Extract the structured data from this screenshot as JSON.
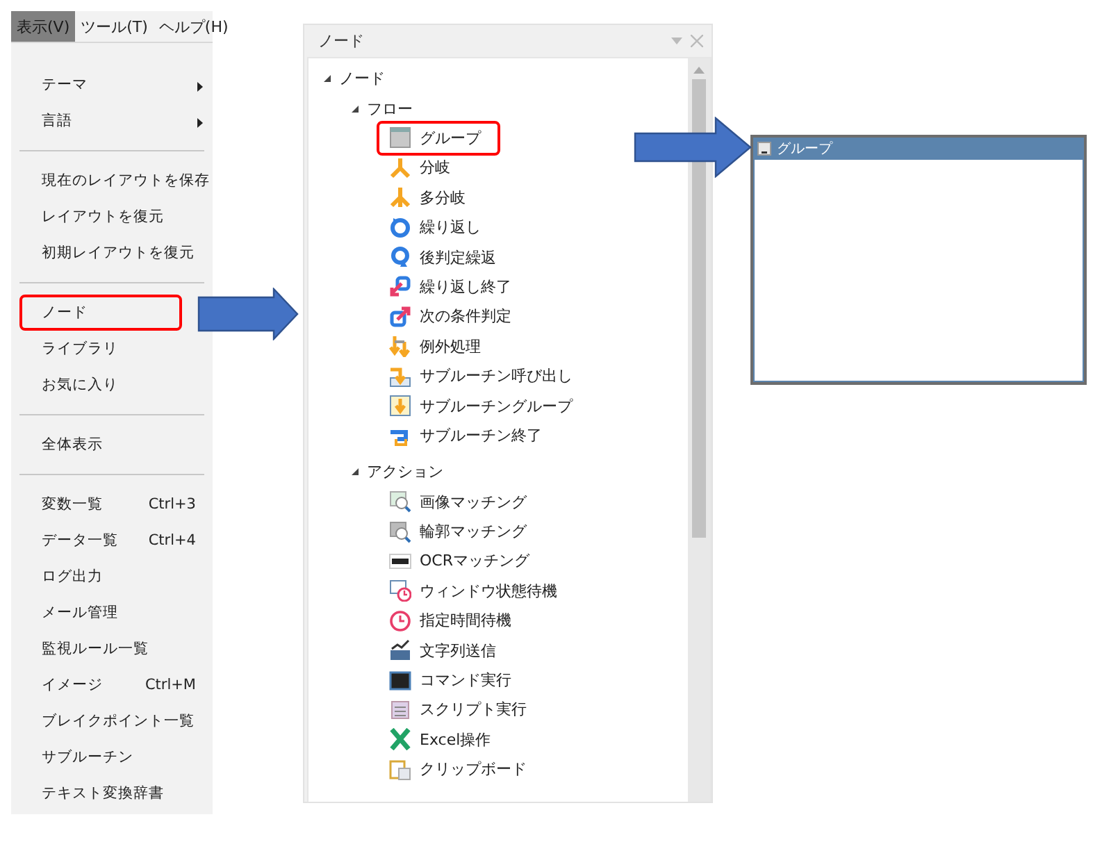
{
  "menubar": [
    {
      "label": "表示(V)",
      "selected": true
    },
    {
      "label": "ツール(T)",
      "selected": false
    },
    {
      "label": "ヘルプ(H)",
      "selected": false
    }
  ],
  "menu": {
    "groups": [
      [
        {
          "label": "テーマ",
          "submenu": true,
          "highlighted": false
        },
        {
          "label": "言語",
          "submenu": true,
          "highlighted": false
        }
      ],
      [
        {
          "label": "現在のレイアウトを保存",
          "submenu": false,
          "highlighted": false
        },
        {
          "label": "レイアウトを復元",
          "submenu": false,
          "highlighted": false
        },
        {
          "label": "初期レイアウトを復元",
          "submenu": false,
          "highlighted": false
        }
      ],
      [
        {
          "label": "ノード",
          "submenu": false,
          "highlighted": true
        },
        {
          "label": "ライブラリ",
          "submenu": false,
          "highlighted": false
        },
        {
          "label": "お気に入り",
          "submenu": false,
          "highlighted": false
        }
      ],
      [
        {
          "label": "全体表示",
          "submenu": false,
          "highlighted": false
        }
      ],
      [
        {
          "label": "変数一覧",
          "shortcut": "Ctrl+3",
          "submenu": false,
          "highlighted": false
        },
        {
          "label": "データ一覧",
          "shortcut": "Ctrl+4",
          "submenu": false,
          "highlighted": false
        },
        {
          "label": "ログ出力",
          "submenu": false,
          "highlighted": false
        },
        {
          "label": "メール管理",
          "submenu": false,
          "highlighted": false
        },
        {
          "label": "監視ルール一覧",
          "submenu": false,
          "highlighted": false
        },
        {
          "label": "イメージ",
          "shortcut": "Ctrl+M",
          "submenu": false,
          "highlighted": false
        },
        {
          "label": "ブレイクポイント一覧",
          "submenu": false,
          "highlighted": false
        },
        {
          "label": "サブルーチン",
          "submenu": false,
          "highlighted": false
        },
        {
          "label": "テキスト変換辞書",
          "submenu": false,
          "highlighted": false
        }
      ]
    ]
  },
  "node_panel": {
    "title": "ノード",
    "tree": {
      "label": "ノード",
      "expanded": true,
      "children": [
        {
          "label": "フロー",
          "expanded": true,
          "children": [
            {
              "label": "グループ",
              "highlighted": true
            },
            {
              "label": "分岐",
              "highlighted": false
            },
            {
              "label": "多分岐",
              "highlighted": false
            },
            {
              "label": "繰り返し",
              "highlighted": false
            },
            {
              "label": "後判定繰返",
              "highlighted": false
            },
            {
              "label": "繰り返し終了",
              "highlighted": false
            },
            {
              "label": "次の条件判定",
              "highlighted": false
            },
            {
              "label": "例外処理",
              "highlighted": false
            },
            {
              "label": "サブルーチン呼び出し",
              "highlighted": false
            },
            {
              "label": "サブルーチングループ",
              "highlighted": false
            },
            {
              "label": "サブルーチン終了",
              "highlighted": false
            }
          ]
        },
        {
          "label": "アクション",
          "expanded": true,
          "children": [
            {
              "label": "画像マッチング",
              "highlighted": false
            },
            {
              "label": "輪郭マッチング",
              "highlighted": false
            },
            {
              "label": "OCRマッチング",
              "highlighted": false
            },
            {
              "label": "ウィンドウ状態待機",
              "highlighted": false
            },
            {
              "label": "指定時間待機",
              "highlighted": false
            },
            {
              "label": "文字列送信",
              "highlighted": false
            },
            {
              "label": "コマンド実行",
              "highlighted": false
            },
            {
              "label": "スクリプト実行",
              "highlighted": false
            },
            {
              "label": "Excel操作",
              "highlighted": false
            },
            {
              "label": "クリップボード",
              "highlighted": false
            }
          ]
        }
      ]
    }
  },
  "group_window": {
    "title": "グループ"
  }
}
